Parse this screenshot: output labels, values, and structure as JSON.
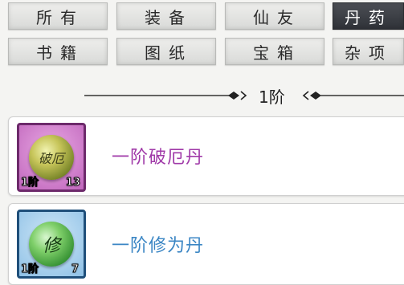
{
  "tabs": {
    "row1": [
      "所有",
      "装备",
      "仙友",
      "丹药"
    ],
    "row2": [
      "书籍",
      "图纸",
      "宝箱",
      "杂项"
    ],
    "active": "丹药"
  },
  "divider": {
    "label": "1阶"
  },
  "items": [
    {
      "name": "一阶破厄丹",
      "icon_text": "破厄",
      "tier": "1阶",
      "count": "13",
      "name_color": "#a03aa8"
    },
    {
      "name": "一阶修为丹",
      "icon_text": "修",
      "tier": "1阶",
      "count": "7",
      "name_color": "#3b86c4"
    }
  ]
}
